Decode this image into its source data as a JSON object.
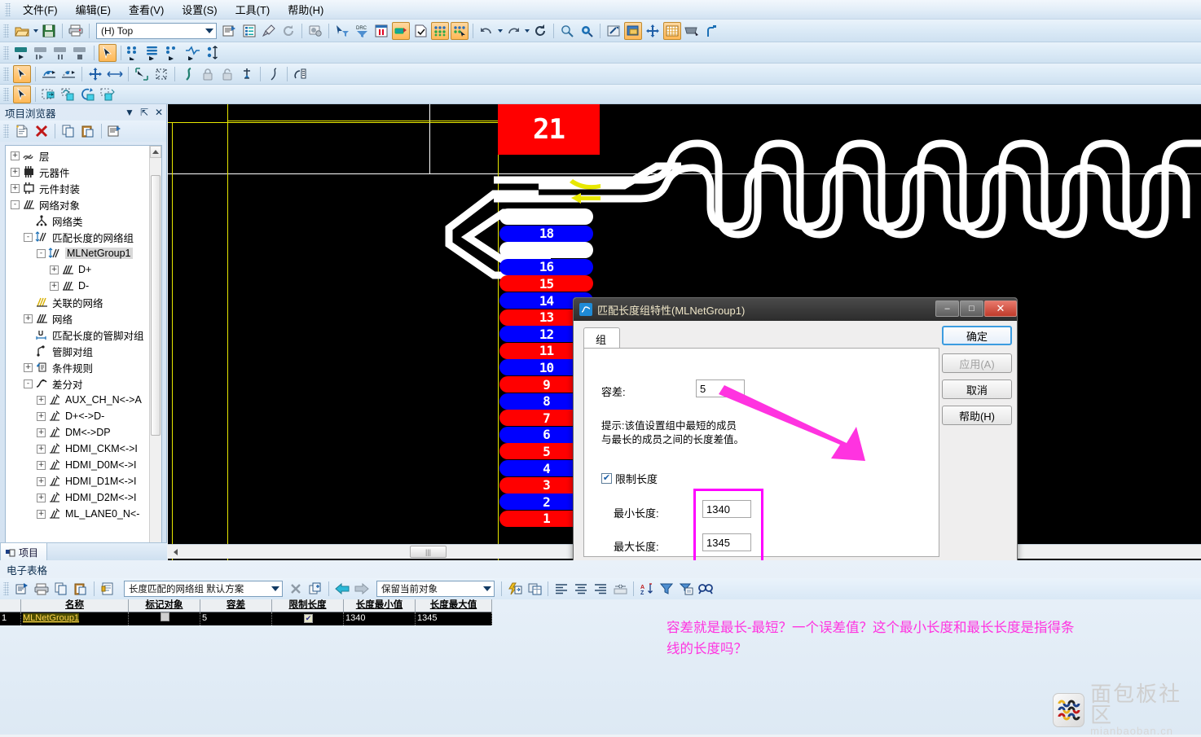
{
  "menu": {
    "items": [
      {
        "label": "文件(F)"
      },
      {
        "label": "编辑(E)"
      },
      {
        "label": "查看(V)"
      },
      {
        "label": "设置(S)"
      },
      {
        "label": "工具(T)"
      },
      {
        "label": "帮助(H)"
      }
    ]
  },
  "toolbar": {
    "layer_combo_value": "(H) Top",
    "icons_row1": [
      "open-file-icon",
      "save-icon",
      "print-icon",
      "properties-icon",
      "list-icon",
      "brush-icon",
      "refresh-icon",
      "camera-settings-icon",
      "select-filter-icon",
      "drc-icon",
      "measure-icon",
      "thermal-icon",
      "check-doc-icon",
      "pads-grid-icon",
      "pads-select-icon",
      "undo-icon",
      "redo-icon",
      "reload-icon",
      "zoom-in-icon",
      "zoom-area-icon",
      "pan-icon",
      "layers-icon",
      "move-icon",
      "grid-icon",
      "keyboard-icon",
      "route-icon"
    ],
    "icons_row2": [
      "play-start-icon",
      "play-step-icon",
      "play-pause-icon",
      "play-stop-icon",
      "pointer-icon",
      "net-route-icon",
      "bus-route-icon",
      "net-end-icon",
      "diff-pair-icon",
      "length-tune-icon"
    ],
    "icons_row3": [
      "pointer-icon",
      "arc-route-icon",
      "arc-route2-icon",
      "move-all-icon",
      "move-h-icon",
      "select-corner-icon",
      "select-box-icon",
      "curve-icon",
      "lock-icon",
      "unlock-icon",
      "anchor-icon",
      "spline-icon",
      "length-icon"
    ],
    "icons_row4": [
      "pointer-icon",
      "copy-place-icon",
      "paste-place-icon",
      "rotate-place-icon",
      "flip-place-icon"
    ]
  },
  "panel": {
    "title": "项目浏览器",
    "title_buttons": [
      "chevron-down-icon",
      "pin-icon",
      "close-icon"
    ],
    "toolbar_icons": [
      "new-doc-icon",
      "delete-red-x-icon",
      "copy-icon",
      "paste-icon",
      "properties-icon"
    ],
    "tab_label": "项目",
    "tree": [
      {
        "label": "层",
        "depth": 0,
        "expander": "+",
        "icon": "layers-icon"
      },
      {
        "label": "元器件",
        "depth": 0,
        "expander": "+",
        "icon": "component-icon"
      },
      {
        "label": "元件封装",
        "depth": 0,
        "expander": "+",
        "icon": "footprint-icon"
      },
      {
        "label": "网络对象",
        "depth": 0,
        "expander": "-",
        "icon": "nets-icon"
      },
      {
        "label": "网络类",
        "depth": 1,
        "expander": "",
        "icon": "netclass-icon"
      },
      {
        "label": "匹配长度的网络组",
        "depth": 1,
        "expander": "-",
        "icon": "matched-length-icon"
      },
      {
        "label": "MLNetGroup1",
        "depth": 2,
        "expander": "-",
        "icon": "matched-length-icon",
        "selected": true
      },
      {
        "label": "D+",
        "depth": 3,
        "expander": "+",
        "icon": "nets-icon"
      },
      {
        "label": "D-",
        "depth": 3,
        "expander": "+",
        "icon": "nets-icon"
      },
      {
        "label": "关联的网络",
        "depth": 1,
        "expander": "",
        "icon": "nets-yellow-icon"
      },
      {
        "label": "网络",
        "depth": 1,
        "expander": "+",
        "icon": "nets-icon"
      },
      {
        "label": "匹配长度的管脚对组",
        "depth": 1,
        "expander": "",
        "icon": "pinpair-len-icon"
      },
      {
        "label": "管脚对组",
        "depth": 1,
        "expander": "",
        "icon": "pinpair-icon"
      },
      {
        "label": "条件规则",
        "depth": 1,
        "expander": "+",
        "icon": "rules-icon"
      },
      {
        "label": "差分对",
        "depth": 1,
        "expander": "-",
        "icon": "diffpair-icon"
      },
      {
        "label": "AUX_CH_N<->A",
        "depth": 2,
        "expander": "+",
        "icon": "diffpair-net-icon"
      },
      {
        "label": "D+<->D-",
        "depth": 2,
        "expander": "+",
        "icon": "diffpair-net-icon"
      },
      {
        "label": "DM<->DP",
        "depth": 2,
        "expander": "+",
        "icon": "diffpair-net-icon"
      },
      {
        "label": "HDMI_CKM<->I",
        "depth": 2,
        "expander": "+",
        "icon": "diffpair-net-icon"
      },
      {
        "label": "HDMI_D0M<->I",
        "depth": 2,
        "expander": "+",
        "icon": "diffpair-net-icon"
      },
      {
        "label": "HDMI_D1M<->I",
        "depth": 2,
        "expander": "+",
        "icon": "diffpair-net-icon"
      },
      {
        "label": "HDMI_D2M<->I",
        "depth": 2,
        "expander": "+",
        "icon": "diffpair-net-icon"
      },
      {
        "label": "ML_LANE0_N<-",
        "depth": 2,
        "expander": "+",
        "icon": "diffpair-net-icon"
      }
    ]
  },
  "canvas": {
    "big_pad_label": "21",
    "pads": [
      {
        "label": "",
        "color": "#ffffff"
      },
      {
        "label": "18",
        "color": "#0000ff"
      },
      {
        "label": "",
        "color": "#ffffff"
      },
      {
        "label": "16",
        "color": "#0000ff"
      },
      {
        "label": "15",
        "color": "#ff0000"
      },
      {
        "label": "14",
        "color": "#0000ff"
      },
      {
        "label": "13",
        "color": "#ff0000"
      },
      {
        "label": "12",
        "color": "#0000ff"
      },
      {
        "label": "11",
        "color": "#ff0000"
      },
      {
        "label": "10",
        "color": "#0000ff"
      },
      {
        "label": "9",
        "color": "#ff0000"
      },
      {
        "label": "8",
        "color": "#0000ff"
      },
      {
        "label": "7",
        "color": "#ff0000"
      },
      {
        "label": "6",
        "color": "#0000ff"
      },
      {
        "label": "5",
        "color": "#ff0000"
      },
      {
        "label": "4",
        "color": "#0000ff"
      },
      {
        "label": "3",
        "color": "#ff0000"
      },
      {
        "label": "2",
        "color": "#0000ff"
      },
      {
        "label": "1",
        "color": "#ff0000"
      }
    ],
    "trace_color": "#ffffff",
    "outline_color": "#e8e800",
    "marker_color": "#e8e800",
    "background": "#000000"
  },
  "dialog": {
    "title": "匹配长度组特性(MLNetGroup1)",
    "icon": "matched-length-icon",
    "window_buttons": {
      "minimize": "–",
      "maximize": "□",
      "close": "✕"
    },
    "tab": "组",
    "tolerance_label": "容差:",
    "tolerance_value": "5",
    "hint_line1": "提示:该值设置组中最短的成员",
    "hint_line2": "与最长的成员之间的长度差值。",
    "limit_length_label": "限制长度",
    "limit_length_checked": true,
    "min_length_label": "最小长度:",
    "min_length_value": "1340",
    "max_length_label": "最大长度:",
    "max_length_value": "1345",
    "buttons": [
      {
        "label": "确定",
        "state": "default"
      },
      {
        "label": "应用(A)",
        "state": "disabled"
      },
      {
        "label": "取消",
        "state": "normal"
      },
      {
        "label": "帮助(H)",
        "state": "normal"
      }
    ],
    "highlight_color": "#ff00ff"
  },
  "spreadsheet": {
    "title": "电子表格",
    "toolbar_icons": [
      "properties-icon",
      "print-icon",
      "copy-icon",
      "paste-icon",
      "insert-icon"
    ],
    "scheme_combo_value": "长度匹配的网络组 默认方案",
    "object_combo_value": "保留当前对象",
    "nav_icons": [
      "delete-x-icon",
      "new-item-icon",
      "back-arrow-icon",
      "forward-arrow-icon"
    ],
    "format_icons": [
      "lightning-icon",
      "table-icon",
      "align-left-icon",
      "align-center-icon",
      "align-right-icon",
      "fit-icon",
      "sort-az-icon",
      "filter-icon",
      "select-icon",
      "find-icon"
    ],
    "columns": [
      "名称",
      "标记对象",
      "容差",
      "限制长度",
      "长度最小值",
      "长度最大值"
    ],
    "rows": [
      {
        "index": "1",
        "name": "MLNetGroup1",
        "marked": false,
        "tolerance": "5",
        "limit_length": true,
        "min_length": "1340",
        "max_length": "1345"
      }
    ]
  },
  "annotation": {
    "line1": "容差就是最长-最短？一个误差值？这个最小长度和最长长度是指得条",
    "line2": "线的长度吗？",
    "color": "#ff33e0"
  },
  "watermark": {
    "title": "面包板社区",
    "subtitle": "mianbaoban.cn",
    "logo": "breadboard-logo-icon"
  }
}
